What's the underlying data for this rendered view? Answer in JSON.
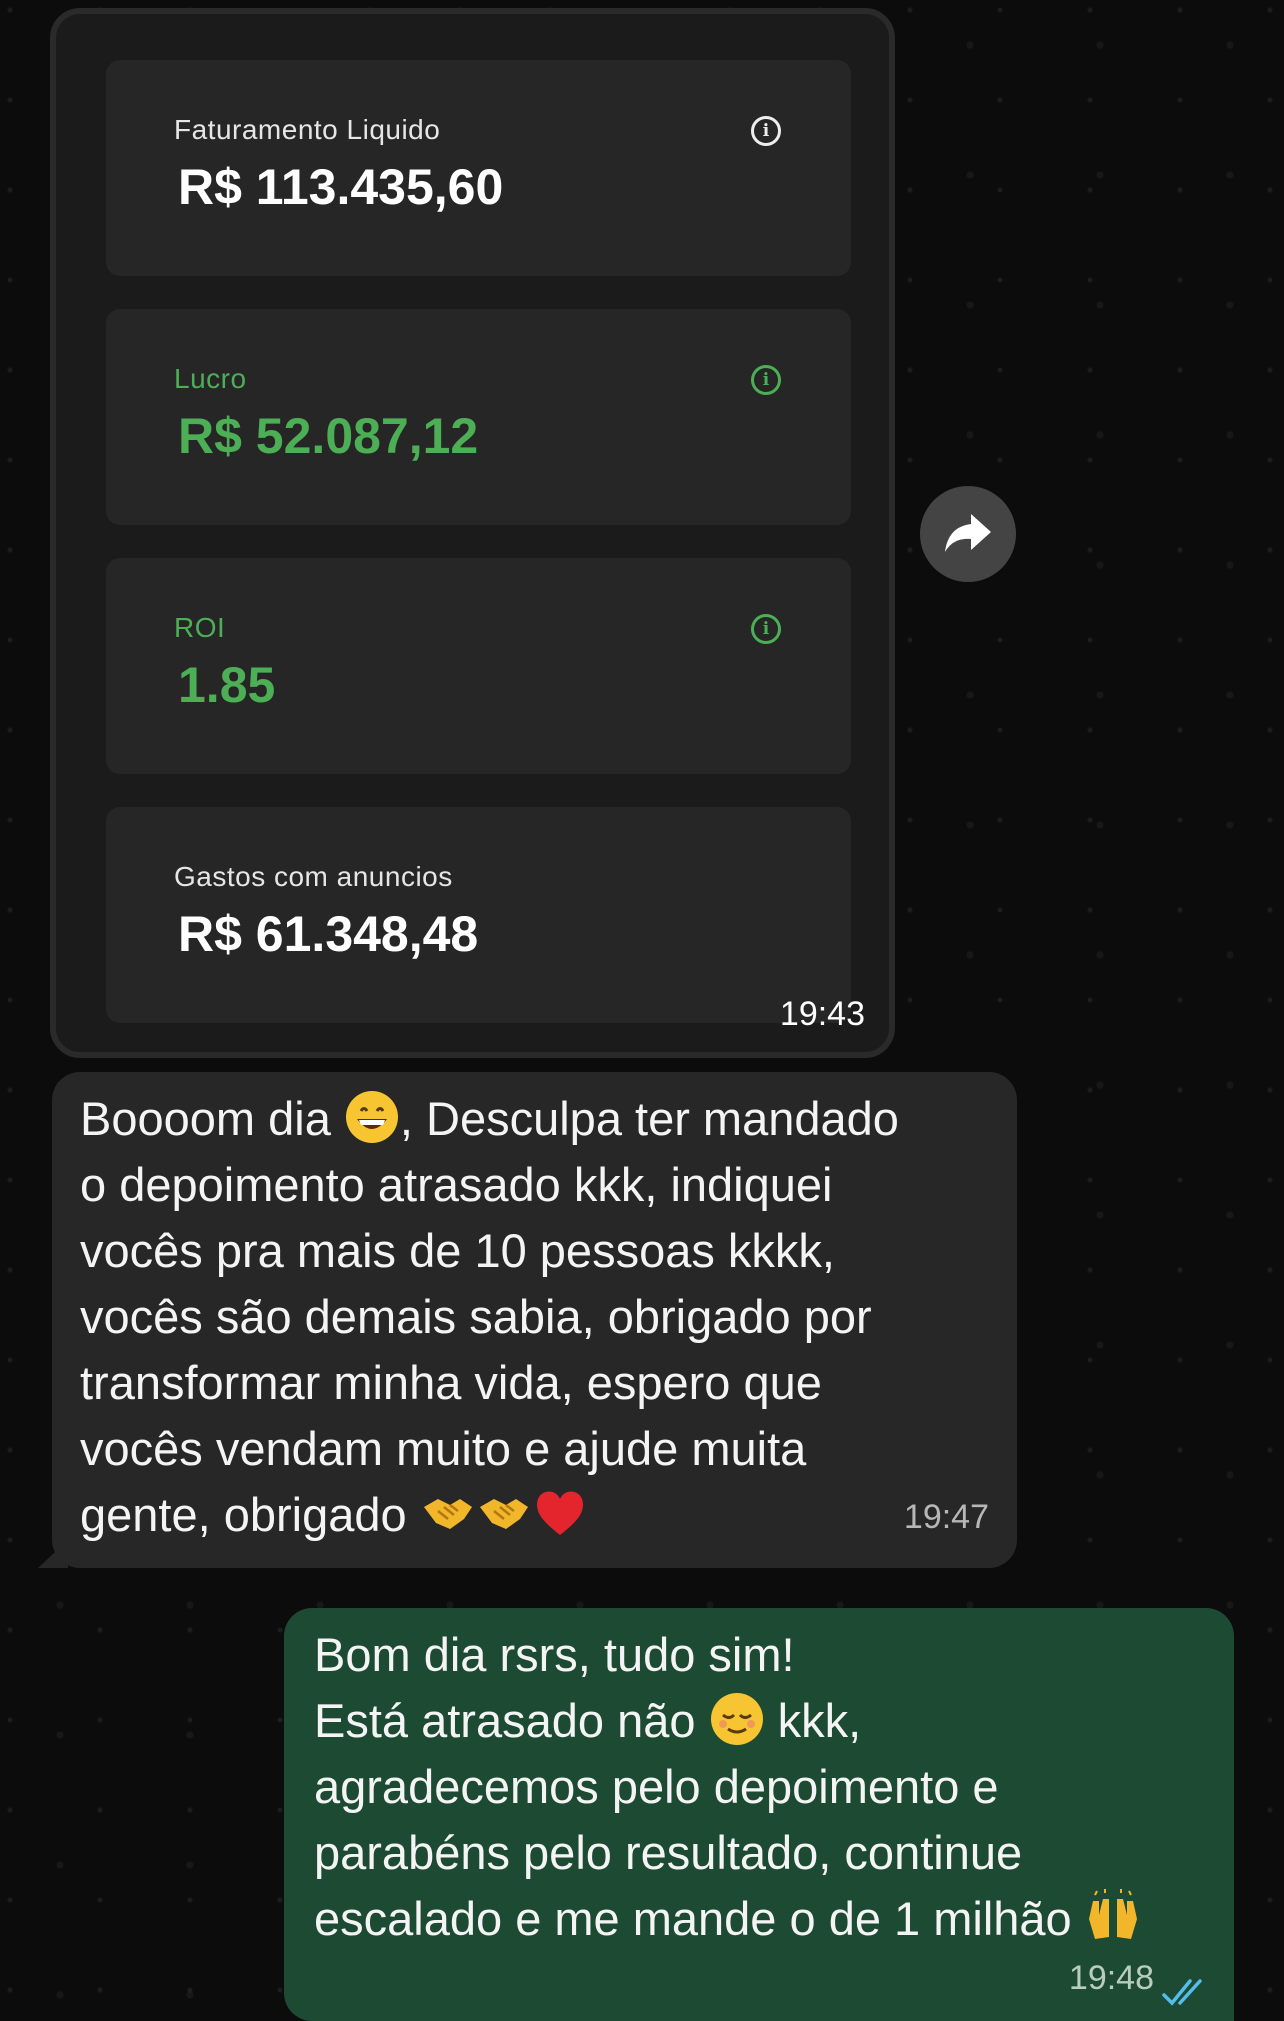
{
  "image_message": {
    "cards": [
      {
        "label": "Faturamento Liquido",
        "value": "R$ 113.435,60",
        "has_info": true
      },
      {
        "label": "Lucro",
        "value": "R$ 52.087,12",
        "has_info": true
      },
      {
        "label": "ROI",
        "value": "1.85",
        "has_info": true
      },
      {
        "label": "Gastos com anuncios",
        "value": "R$ 61.348,48",
        "has_info": false
      }
    ],
    "info_glyph": "i",
    "time": "19:43"
  },
  "incoming_message": {
    "lines": [
      "Boooom dia",
      ", Desculpa ter mandado",
      "o depoimento atrasado kkk, indiquei",
      "vocês pra mais de 10 pessoas kkkk,",
      "vocês são demais sabia, obrigado por",
      "transformar minha vida, espero que",
      "vocês vendam muito e ajude muita",
      "gente, obrigado"
    ],
    "emojis": [
      "grinning-face",
      "handshake",
      "handshake",
      "red-heart"
    ],
    "time": "19:47"
  },
  "outgoing_message": {
    "lines": [
      "Bom dia rsrs, tudo sim!",
      "Está atrasado não",
      "kkk,",
      "agradecemos pelo depoimento e",
      "parabéns pelo resultado, continue",
      "escalado e me mande o de 1 milhão"
    ],
    "emojis": [
      "relieved-face",
      "raising-hands"
    ],
    "time": "19:48",
    "status": "read"
  },
  "colors": {
    "background": "#0b0b0b",
    "card": "#262626",
    "positive": "#4cae55",
    "incoming_bubble": "#272727",
    "outgoing_bubble": "#1d4a33",
    "read_tick": "#53bdeb"
  }
}
